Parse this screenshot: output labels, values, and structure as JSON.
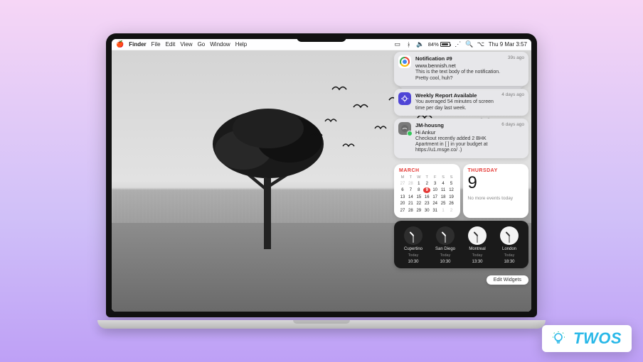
{
  "menubar": {
    "app_title": "Finder",
    "menus": [
      "File",
      "Edit",
      "View",
      "Go",
      "Window",
      "Help"
    ],
    "right": {
      "icons": [
        "screen-mirror-icon",
        "bluetooth-icon",
        "volume-icon",
        "wifi-icon",
        "search-icon",
        "control-center-icon"
      ],
      "battery_percent": "84%",
      "datetime": "Thu 9 Mar  3:57"
    }
  },
  "notifications": [
    {
      "icon": "chrome",
      "title": "Notification #9",
      "subtitle": "www.bennish.net",
      "body_1": "This is the text body of the notification.",
      "body_2": "Pretty cool, huh?",
      "time": "39s ago"
    },
    {
      "icon": "screentime",
      "title": "Weekly Report Available",
      "subtitle": "",
      "body_1": "You averaged 54 minutes of screen time per day last week.",
      "body_2": "",
      "time": "4 days ago"
    },
    {
      "icon": "generic",
      "title": "JM-housng",
      "subtitle": "Hi Ankur",
      "body_1": "Checkout recently added 2 BHK Apartment in [           ] in your budget at https://u1.msge.co/            .)",
      "body_2": "",
      "time": "6 days ago"
    }
  ],
  "calendar": {
    "month_label": "MARCH",
    "dows": [
      "M",
      "T",
      "W",
      "T",
      "F",
      "S",
      "S"
    ],
    "cells": [
      {
        "n": "27",
        "dim": true
      },
      {
        "n": "28",
        "dim": true
      },
      {
        "n": "1"
      },
      {
        "n": "2"
      },
      {
        "n": "3"
      },
      {
        "n": "4"
      },
      {
        "n": "5"
      },
      {
        "n": "6"
      },
      {
        "n": "7"
      },
      {
        "n": "8"
      },
      {
        "n": "9",
        "today": true
      },
      {
        "n": "10"
      },
      {
        "n": "11"
      },
      {
        "n": "12"
      },
      {
        "n": "13"
      },
      {
        "n": "14"
      },
      {
        "n": "15"
      },
      {
        "n": "16"
      },
      {
        "n": "17"
      },
      {
        "n": "18"
      },
      {
        "n": "19"
      },
      {
        "n": "20"
      },
      {
        "n": "21"
      },
      {
        "n": "22"
      },
      {
        "n": "23"
      },
      {
        "n": "24"
      },
      {
        "n": "25"
      },
      {
        "n": "26"
      },
      {
        "n": "27"
      },
      {
        "n": "28"
      },
      {
        "n": "29"
      },
      {
        "n": "30"
      },
      {
        "n": "31"
      },
      {
        "n": "1",
        "dim": true
      },
      {
        "n": "2",
        "dim": true
      }
    ]
  },
  "date_widget": {
    "label": "THURSDAY",
    "day": "9",
    "sub": "No more events today"
  },
  "world_clock": {
    "cities": [
      {
        "name": "Cupertino",
        "day": "Today",
        "time": "10:30"
      },
      {
        "name": "San Diego",
        "day": "Today",
        "time": "10:30"
      },
      {
        "name": "Montreal",
        "day": "Today",
        "time": "13:30"
      },
      {
        "name": "London",
        "day": "Today",
        "time": "18:30"
      }
    ]
  },
  "edit_widgets_label": "Edit Widgets",
  "watermark_text": "TWOS"
}
